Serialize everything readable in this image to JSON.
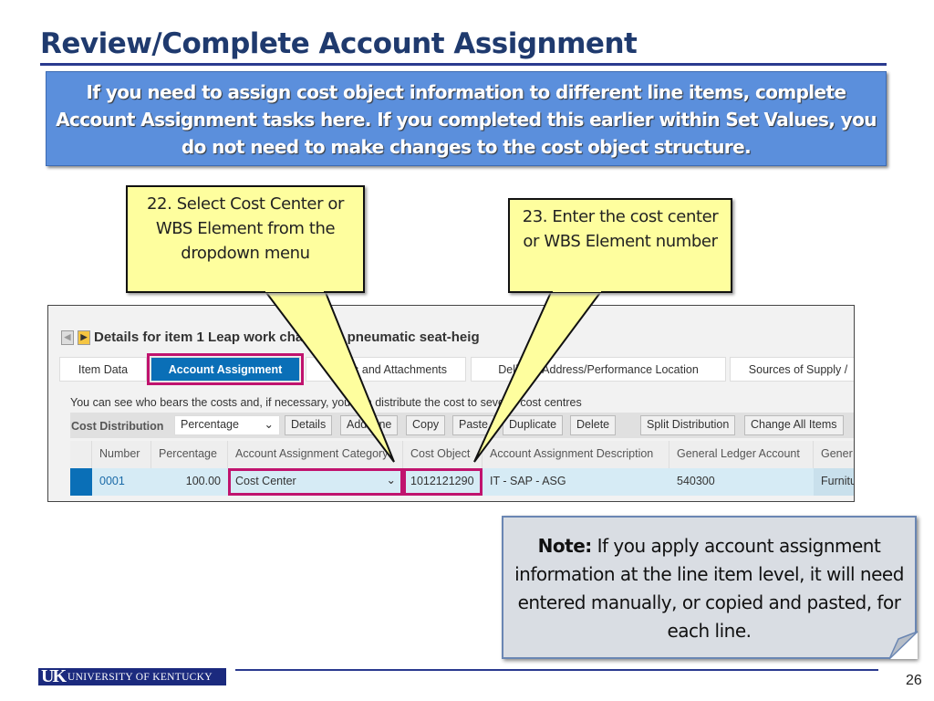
{
  "title": "Review/Complete Account Assignment",
  "banner": "If you need to assign cost object information to different line items, complete Account Assignment tasks here. If you completed this earlier within Set Values, you do not need to make changes to the cost object structure.",
  "callouts": [
    {
      "text": "22. Select Cost Center or WBS Element from the dropdown menu"
    },
    {
      "text": "23. Enter the cost center or WBS Element number"
    }
  ],
  "sap": {
    "header": "Details for item 1  Leap work chair with pneumatic seat-heig",
    "tabs": [
      "Item Data",
      "Account Assignment",
      "Notes and Attachments",
      "Delivery Address/Performance Location",
      "Sources of Supply /"
    ],
    "info": "You can see who bears the costs and, if necessary, you can distribute the cost to several cost centres",
    "toolbar_label": "Cost Distribution",
    "distribution_select": "Percentage",
    "buttons": [
      "Details",
      "Add Line",
      "Copy",
      "Paste",
      "Duplicate",
      "Delete",
      "Split Distribution",
      "Change All Items"
    ],
    "columns": [
      "Number",
      "Percentage",
      "Account Assignment Category",
      "Cost Object",
      "Account Assignment Description",
      "General Ledger Account",
      "Gener"
    ],
    "row": [
      "0001",
      "100.00",
      "Cost Center",
      "1012121290",
      "IT - SAP - ASG",
      "540300",
      "Furnitu"
    ],
    "highlight_color": "#c0136e"
  },
  "note": {
    "bold": "Note:",
    "text": " If you apply account assignment information at the line item level, it will need entered manually, or copied and pasted, for each line."
  },
  "footer": {
    "logo": "UK UNIVERSITY OF KENTUCKY",
    "page": "26"
  }
}
